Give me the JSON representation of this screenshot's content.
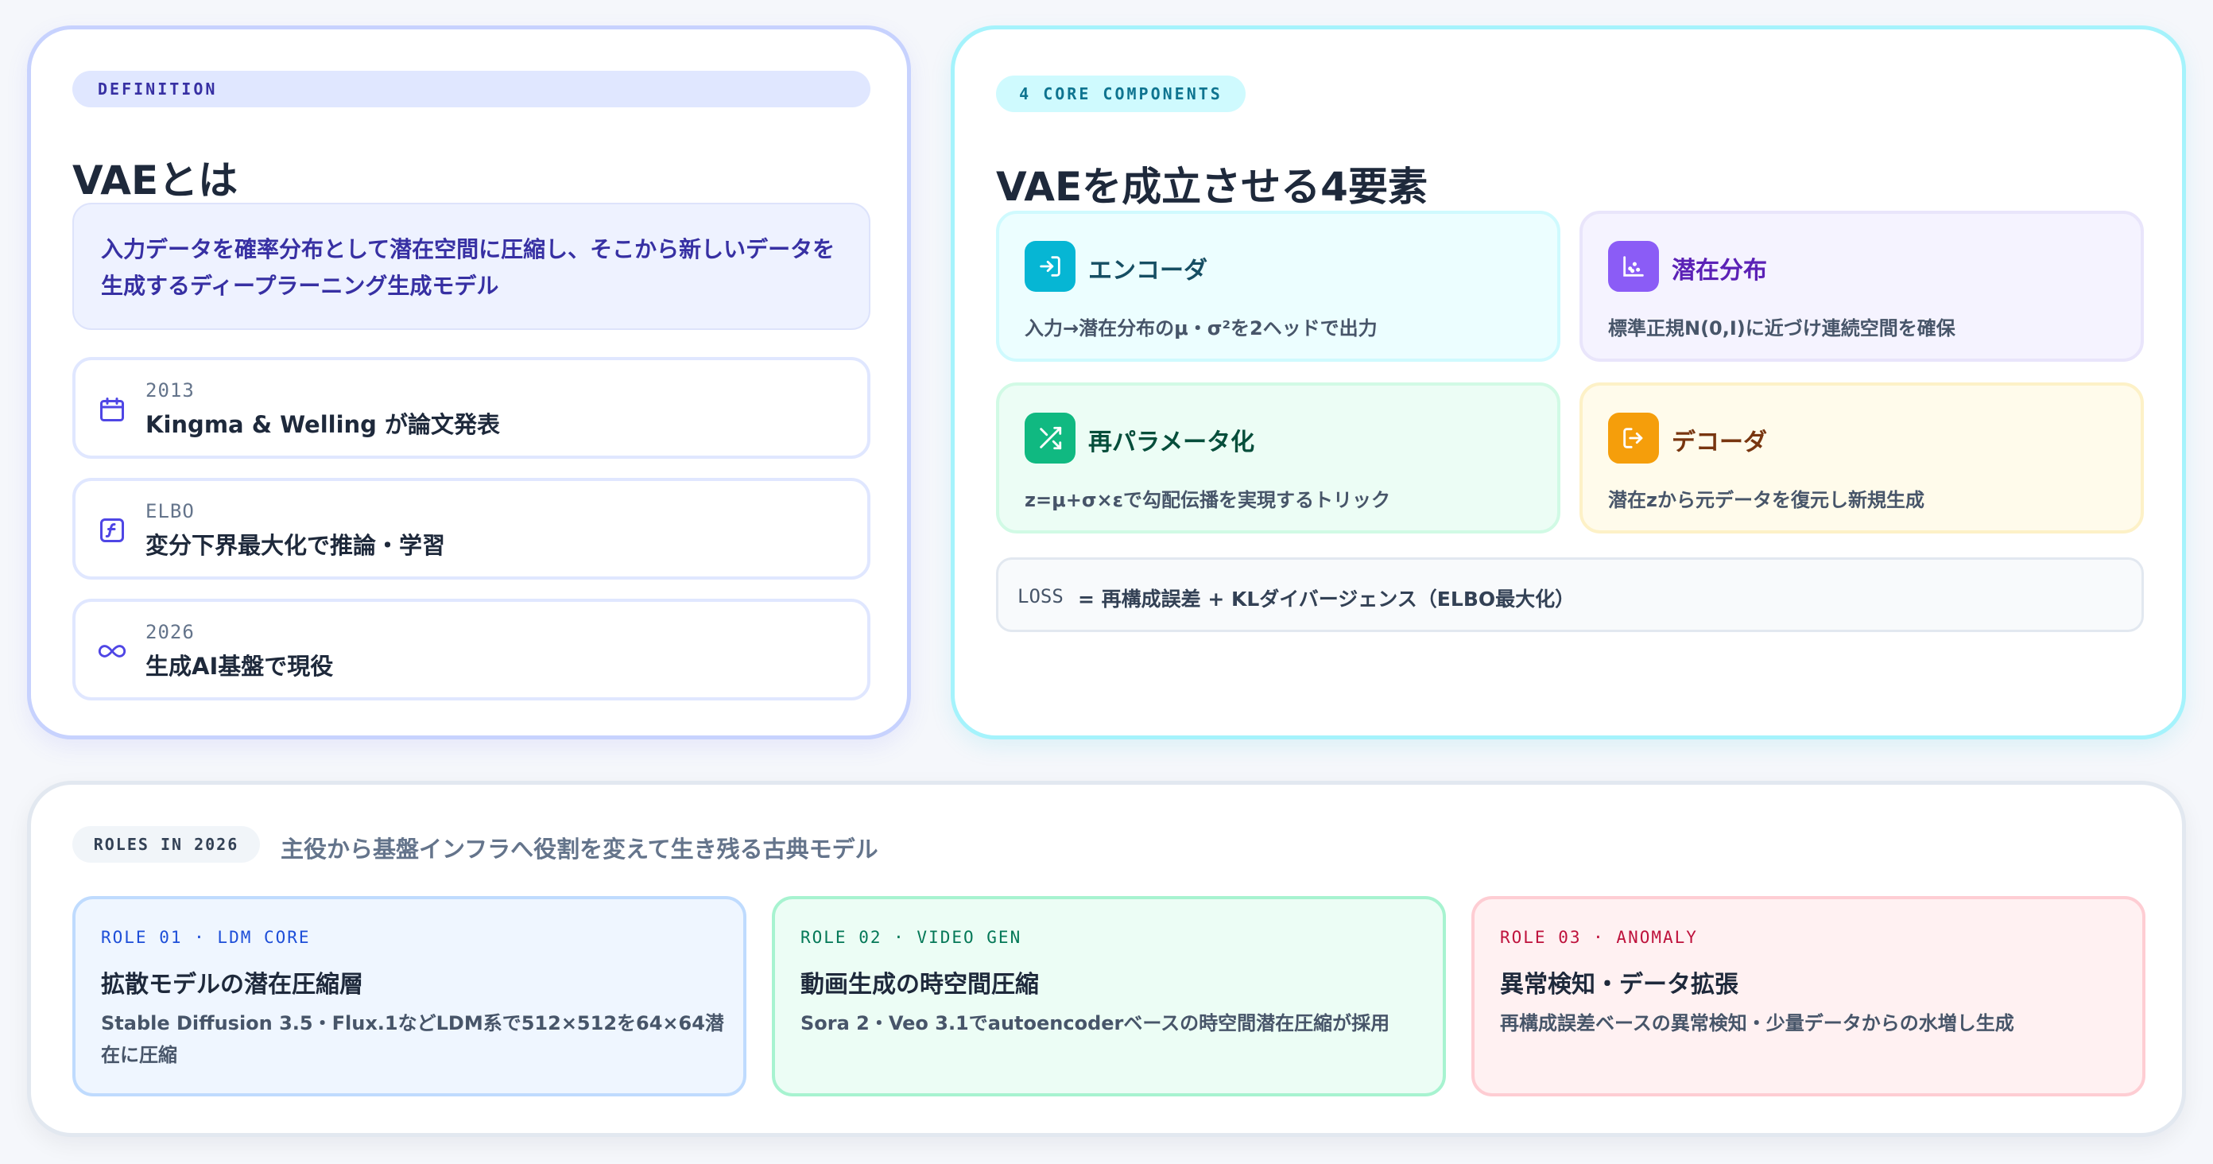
{
  "definition": {
    "tag": "DEFINITION",
    "title": "VAEとは",
    "summary": "入力データを確率分布として潜在空間に圧縮し、そこから新しいデータを生成するディープラーニング生成モデル",
    "facts": [
      {
        "icon": "calendar-icon",
        "label": "2013",
        "text": "Kingma & Welling が論文発表"
      },
      {
        "icon": "function-icon",
        "label": "ELBO",
        "text": "変分下界最大化で推論・学習"
      },
      {
        "icon": "infinity-icon",
        "label": "2026",
        "text": "生成AI基盤で現役"
      }
    ]
  },
  "components": {
    "tag": "4 CORE COMPONENTS",
    "title": "VAEを成立させる4要素",
    "items": [
      {
        "icon": "sign-in-icon",
        "name": "エンコーダ",
        "desc": "入力→潜在分布のμ・σ²を2ヘッドで出力",
        "color": "#06b6d4"
      },
      {
        "icon": "scatter-icon",
        "name": "潜在分布",
        "desc": "標準正規N(0,I)に近づけ連続空間を確保",
        "color": "#8b5cf6"
      },
      {
        "icon": "shuffle-icon",
        "name": "再パラメータ化",
        "desc": "z=μ+σ×εで勾配伝播を実現するトリック",
        "color": "#10b981"
      },
      {
        "icon": "sign-out-icon",
        "name": "デコーダ",
        "desc": "潜在zから元データを復元し新規生成",
        "color": "#f59e0b"
      }
    ],
    "loss": {
      "label": "LOSS",
      "value": "= 再構成誤差 + KLダイバージェンス（ELBO最大化）"
    }
  },
  "roles": {
    "tag": "ROLES IN 2026",
    "subtitle": "主役から基盤インフラへ役割を変えて生き残る古典モデル",
    "items": [
      {
        "tag": "ROLE 01 · LDM CORE",
        "title": "拡散モデルの潜在圧縮層",
        "desc": "Stable Diffusion 3.5・Flux.1などLDM系で512×512を64×64潜在に圧縮",
        "color": "#1d4ed8"
      },
      {
        "tag": "ROLE 02 · VIDEO GEN",
        "title": "動画生成の時空間圧縮",
        "desc": "Sora 2・Veo 3.1でautoencoderベースの時空間潜在圧縮が採用",
        "color": "#047857"
      },
      {
        "tag": "ROLE 03 · ANOMALY",
        "title": "異常検知・データ拡張",
        "desc": "再構成誤差ベースの異常検知・少量データからの水増し生成",
        "color": "#be123c"
      }
    ]
  }
}
